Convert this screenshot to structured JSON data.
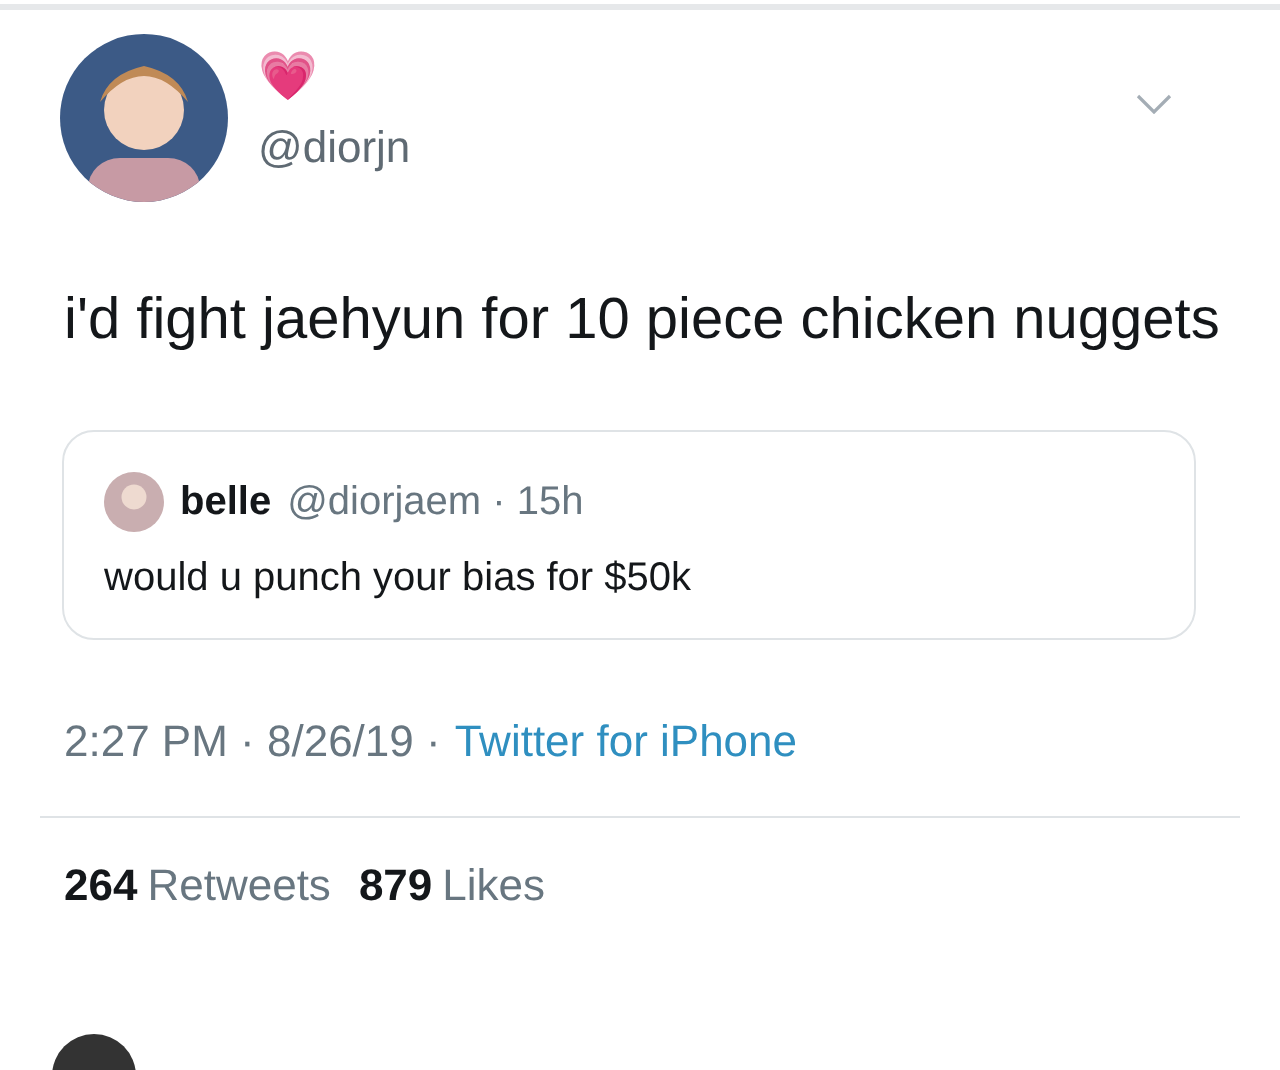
{
  "tweet": {
    "display_name_emoji": "💗",
    "handle": "@diorjn",
    "text": "i'd fight jaehyun for 10 piece chicken nuggets",
    "quoted": {
      "name": "belle",
      "handle_time": "@diorjaem · 15h",
      "text": "would u punch your bias for $50k"
    },
    "timestamp": "2:27 PM · 8/26/19 ·",
    "source": "Twitter for iPhone",
    "stats": [
      {
        "count": "264",
        "label": "Retweets"
      },
      {
        "count": "879",
        "label": "Likes"
      }
    ]
  }
}
